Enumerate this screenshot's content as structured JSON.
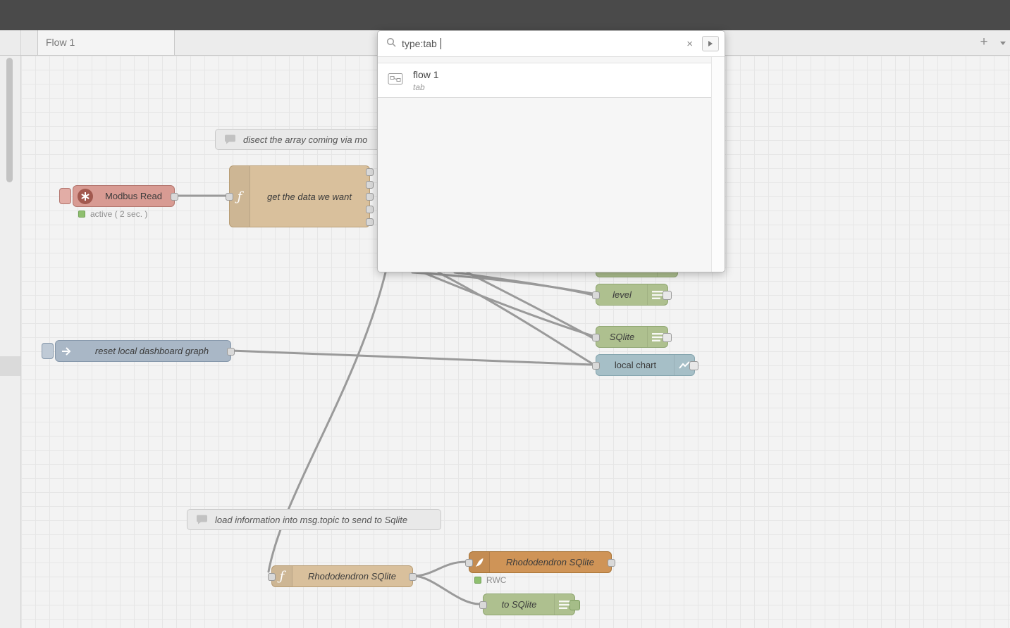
{
  "colors": {
    "header": "#4a4a4a",
    "canvas_bg": "#f3f3f3",
    "grid_line": "#e6e6e6",
    "wire": "#9a9a9a",
    "modbus_node": "#d89b93",
    "modbus_border": "#b3766e",
    "function_node": "#d9c09c",
    "function_border": "#b99e76",
    "sqlite_node": "#aec08f",
    "sqlite_border": "#8fa671",
    "chart_node": "#a6bfc7",
    "chart_border": "#85a5ae",
    "inject_node": "#a9b7c6",
    "inject_border": "#8698ab",
    "orange_node": "#cf9457",
    "orange_border": "#a87436",
    "comment_node": "#e9e9e9",
    "comment_border": "#c9c9c9",
    "status_green": "#8fbf6f",
    "port_fill": "#d9d9d9",
    "port_border": "#999999"
  },
  "icons": {
    "search": "magnifier",
    "clear": "x-cross",
    "search_options": "right-caret",
    "tab_menu": "down-caret",
    "comment": "speech-bubble",
    "function": "f-glyph",
    "modbus": "asterisk-star",
    "inject": "right-arrow",
    "sqlite_file": "list-lines",
    "chart": "line-chart",
    "feather": "quill-feather",
    "flow_tab": "mini-flow-window",
    "status": "green-square"
  },
  "tabbar": {
    "tabs": [
      {
        "label": "Flow 1"
      }
    ],
    "add_button": "+"
  },
  "search": {
    "query": "type:tab",
    "clear_button": "×",
    "results": [
      {
        "title": "flow 1",
        "subtitle": "tab"
      }
    ]
  },
  "canvas": {
    "comments": {
      "disect": "disect the array coming via mo",
      "load_info": "load information into msg.topic to send to Sqlite"
    },
    "nodes": {
      "modbus_read": {
        "label": "Modbus Read",
        "status": "active ( 2 sec. )"
      },
      "get_data_fn": {
        "label": "get the data we want"
      },
      "level": {
        "label": "level"
      },
      "sqlite": {
        "label": "SQlite"
      },
      "local_chart": {
        "label": "local chart"
      },
      "reset_graph": {
        "label": "reset local dashboard graph"
      },
      "rhododendron_fn": {
        "label": "Rhododendron SQlite"
      },
      "rhododendron_sqlite": {
        "label": "Rhododendron SQlite",
        "status": "RWC"
      },
      "to_sqlite": {
        "label": "to SQlite"
      }
    }
  }
}
